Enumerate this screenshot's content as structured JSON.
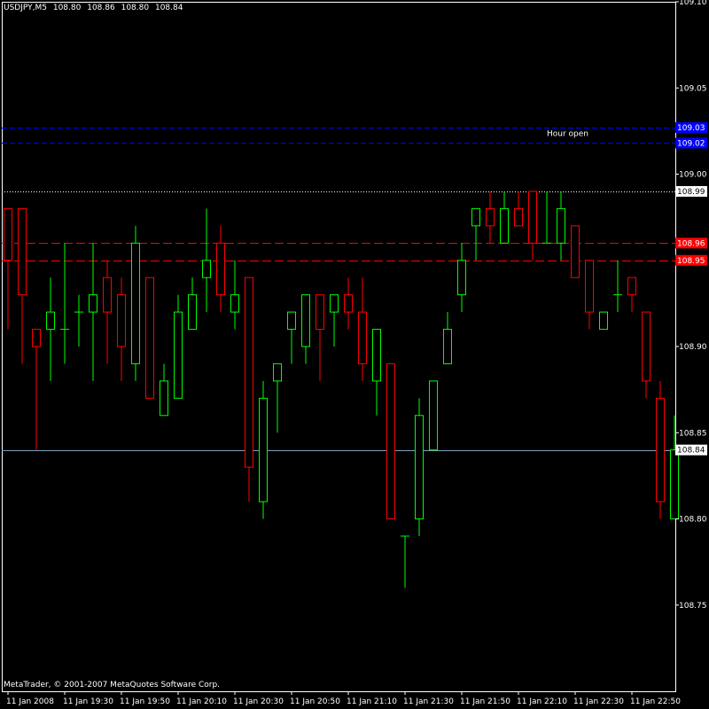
{
  "header": {
    "symbol": "USDJPY,M5",
    "ohlc": [
      "108.80",
      "108.86",
      "108.80",
      "108.84"
    ]
  },
  "footer": {
    "copyright": "MetaTrader, © 2001-2007 MetaQuotes Software Corp."
  },
  "colors": {
    "background": "#000000",
    "axis": "#ffffff",
    "bull": "#00ff00",
    "bear": "#ff0000",
    "hline_blue": "#0000ff",
    "hline_red": "#ff0000",
    "bid_line": "#7f9fbf",
    "top_dotted": "#ffffff"
  },
  "chart_data": {
    "type": "candlestick",
    "ylim": [
      108.7,
      109.1
    ],
    "y_ticks": [
      "109.10",
      "109.05",
      "109.00",
      "108.95",
      "108.90",
      "108.85",
      "108.80",
      "108.75"
    ],
    "x_ticks": [
      "11 Jan 2008",
      "11 Jan 19:30",
      "11 Jan 19:50",
      "11 Jan 20:10",
      "11 Jan 20:30",
      "11 Jan 20:50",
      "11 Jan 21:10",
      "11 Jan 21:30",
      "11 Jan 21:50",
      "11 Jan 22:10",
      "11 Jan 22:30",
      "11 Jan 22:50"
    ],
    "candles": [
      {
        "o": 108.98,
        "h": 108.98,
        "l": 108.91,
        "c": 108.95
      },
      {
        "o": 108.98,
        "h": 108.98,
        "l": 108.89,
        "c": 108.93
      },
      {
        "o": 108.91,
        "h": 108.91,
        "l": 108.84,
        "c": 108.9
      },
      {
        "o": 108.91,
        "h": 108.94,
        "l": 108.88,
        "c": 108.92
      },
      {
        "o": 108.91,
        "h": 108.96,
        "l": 108.89,
        "c": 108.91
      },
      {
        "o": 108.92,
        "h": 108.93,
        "l": 108.9,
        "c": 108.92
      },
      {
        "o": 108.92,
        "h": 108.96,
        "l": 108.88,
        "c": 108.93
      },
      {
        "o": 108.94,
        "h": 108.95,
        "l": 108.89,
        "c": 108.92
      },
      {
        "o": 108.93,
        "h": 108.94,
        "l": 108.88,
        "c": 108.9
      },
      {
        "o": 108.89,
        "h": 108.97,
        "l": 108.88,
        "c": 108.96
      },
      {
        "o": 108.94,
        "h": 108.94,
        "l": 108.87,
        "c": 108.87
      },
      {
        "o": 108.86,
        "h": 108.89,
        "l": 108.86,
        "c": 108.88
      },
      {
        "o": 108.87,
        "h": 108.93,
        "l": 108.87,
        "c": 108.92
      },
      {
        "o": 108.91,
        "h": 108.94,
        "l": 108.91,
        "c": 108.93
      },
      {
        "o": 108.94,
        "h": 108.98,
        "l": 108.92,
        "c": 108.95
      },
      {
        "o": 108.96,
        "h": 108.97,
        "l": 108.92,
        "c": 108.93
      },
      {
        "o": 108.92,
        "h": 108.95,
        "l": 108.91,
        "c": 108.93
      },
      {
        "o": 108.94,
        "h": 108.94,
        "l": 108.81,
        "c": 108.83
      },
      {
        "o": 108.81,
        "h": 108.88,
        "l": 108.8,
        "c": 108.87
      },
      {
        "o": 108.88,
        "h": 108.89,
        "l": 108.85,
        "c": 108.89
      },
      {
        "o": 108.91,
        "h": 108.92,
        "l": 108.89,
        "c": 108.92
      },
      {
        "o": 108.9,
        "h": 108.93,
        "l": 108.89,
        "c": 108.93
      },
      {
        "o": 108.93,
        "h": 108.93,
        "l": 108.88,
        "c": 108.91
      },
      {
        "o": 108.92,
        "h": 108.93,
        "l": 108.9,
        "c": 108.93
      },
      {
        "o": 108.93,
        "h": 108.94,
        "l": 108.91,
        "c": 108.92
      },
      {
        "o": 108.92,
        "h": 108.94,
        "l": 108.88,
        "c": 108.89
      },
      {
        "o": 108.88,
        "h": 108.91,
        "l": 108.86,
        "c": 108.91
      },
      {
        "o": 108.89,
        "h": 108.89,
        "l": 108.8,
        "c": 108.8
      },
      {
        "o": 108.79,
        "h": 108.79,
        "l": 108.76,
        "c": 108.79
      },
      {
        "o": 108.8,
        "h": 108.87,
        "l": 108.79,
        "c": 108.86
      },
      {
        "o": 108.84,
        "h": 108.88,
        "l": 108.84,
        "c": 108.88
      },
      {
        "o": 108.89,
        "h": 108.92,
        "l": 108.89,
        "c": 108.91
      },
      {
        "o": 108.93,
        "h": 108.96,
        "l": 108.92,
        "c": 108.95
      },
      {
        "o": 108.97,
        "h": 108.98,
        "l": 108.95,
        "c": 108.98
      },
      {
        "o": 108.98,
        "h": 108.99,
        "l": 108.96,
        "c": 108.97
      },
      {
        "o": 108.96,
        "h": 108.99,
        "l": 108.96,
        "c": 108.98
      },
      {
        "o": 108.98,
        "h": 108.99,
        "l": 108.97,
        "c": 108.97
      },
      {
        "o": 108.99,
        "h": 108.99,
        "l": 108.95,
        "c": 108.96
      },
      {
        "o": 108.96,
        "h": 108.99,
        "l": 108.96,
        "c": 108.96
      },
      {
        "o": 108.96,
        "h": 108.99,
        "l": 108.95,
        "c": 108.98
      },
      {
        "o": 108.97,
        "h": 108.97,
        "l": 108.94,
        "c": 108.94
      },
      {
        "o": 108.95,
        "h": 108.95,
        "l": 108.91,
        "c": 108.92
      },
      {
        "o": 108.91,
        "h": 108.92,
        "l": 108.91,
        "c": 108.92
      },
      {
        "o": 108.93,
        "h": 108.95,
        "l": 108.92,
        "c": 108.93
      },
      {
        "o": 108.94,
        "h": 108.94,
        "l": 108.92,
        "c": 108.93
      },
      {
        "o": 108.92,
        "h": 108.92,
        "l": 108.87,
        "c": 108.88
      },
      {
        "o": 108.87,
        "h": 108.88,
        "l": 108.8,
        "c": 108.81
      },
      {
        "o": 108.8,
        "h": 108.86,
        "l": 108.8,
        "c": 108.84
      }
    ],
    "hlines": [
      {
        "value": 109.027,
        "label": "109.03",
        "style": "blue"
      },
      {
        "value": 109.018,
        "label": "109.02",
        "style": "blue"
      },
      {
        "value": 108.99,
        "label": "108.99",
        "style": "white-dotted"
      },
      {
        "value": 108.96,
        "label": "108.96",
        "style": "red"
      },
      {
        "value": 108.95,
        "label": "108.95",
        "style": "red"
      },
      {
        "value": 108.84,
        "label": "108.84",
        "style": "bid"
      }
    ],
    "annotations": [
      {
        "text": "Hour open"
      }
    ]
  }
}
